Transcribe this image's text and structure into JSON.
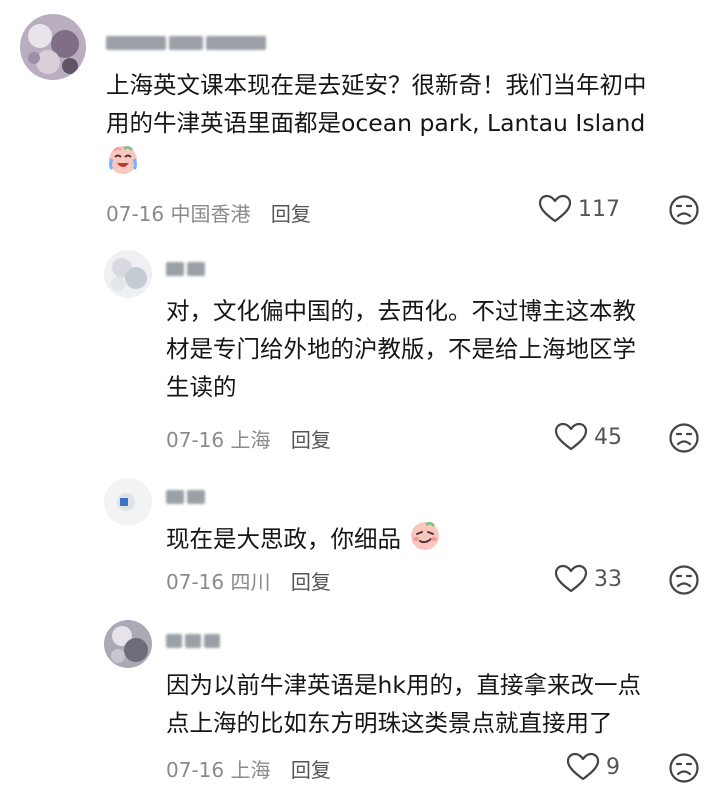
{
  "comments": [
    {
      "username": "",
      "text_lines": [
        "上海英文课本现在是去延安？很新奇！我们当年初中",
        "用的牛津英语里面都是ocean park, Lantau Island"
      ],
      "emoji": "crying-laughing-face",
      "date": "07-16",
      "location": "中国香港",
      "reply_label": "回复",
      "likes": "117"
    },
    {
      "username": "",
      "text_lines": [
        "对，文化偏中国的，去西化。不过博主这本教",
        "材是专门给外地的沪教版，不是给上海地区学",
        "生读的"
      ],
      "date": "07-16",
      "location": "上海",
      "reply_label": "回复",
      "likes": "45"
    },
    {
      "username": "",
      "text_lines": [
        "现在是大思政，你细品"
      ],
      "emoji": "smirking-face",
      "date": "07-16",
      "location": "四川",
      "reply_label": "回复",
      "likes": "33"
    },
    {
      "username": "",
      "text_lines": [
        "因为以前牛津英语是hk用的，直接拿来改一点",
        "点上海的比如东方明珠这类景点就直接用了"
      ],
      "date": "07-16",
      "location": "上海",
      "reply_label": "回复",
      "likes": "9"
    }
  ],
  "icons": {
    "like": "heart-outline-icon",
    "dislike": "sad-face-icon"
  },
  "colors": {
    "text": "#161616",
    "meta": "#8a8a8a",
    "icon": "#444444"
  }
}
